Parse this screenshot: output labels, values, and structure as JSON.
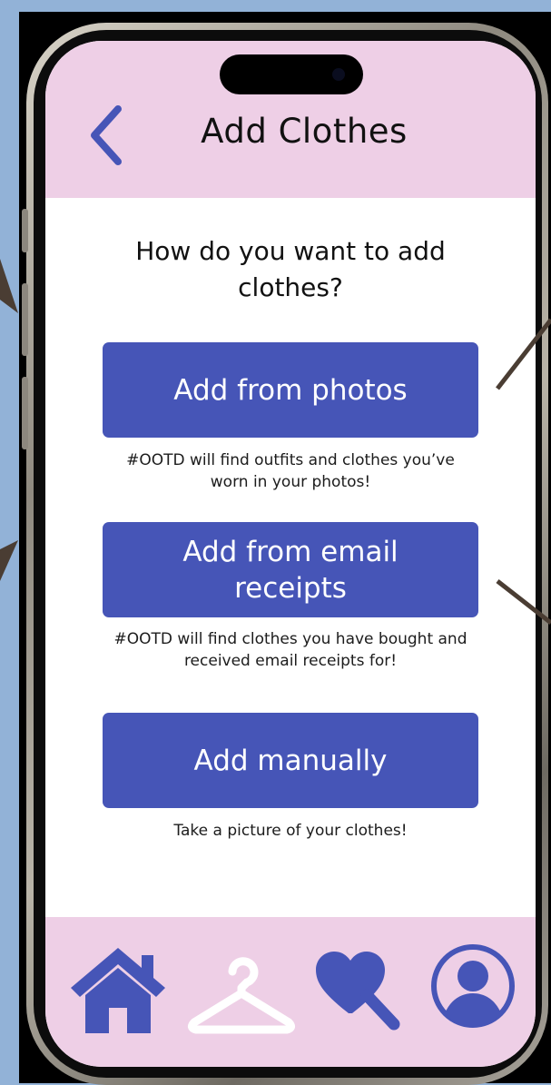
{
  "header": {
    "title": "Add Clothes"
  },
  "main": {
    "question": "How do you want to add clothes?",
    "options": [
      {
        "label": "Add from photos",
        "description": "#OOTD will find outfits and clothes you’ve worn in your photos!"
      },
      {
        "label": "Add from email receipts",
        "description": "#OOTD will find clothes you have bought and received email receipts for!"
      },
      {
        "label": "Add manually",
        "description": "Take a picture of your clothes!"
      }
    ]
  },
  "nav": {
    "items": [
      "home-icon",
      "hanger-icon",
      "heart-search-icon",
      "profile-icon"
    ]
  },
  "colors": {
    "primary": "#4655b7",
    "header_bg": "#eecfe6",
    "nav_bg": "#eecfe6",
    "canvas_bg": "#92b2d7",
    "arrow": "#4a3d33"
  }
}
